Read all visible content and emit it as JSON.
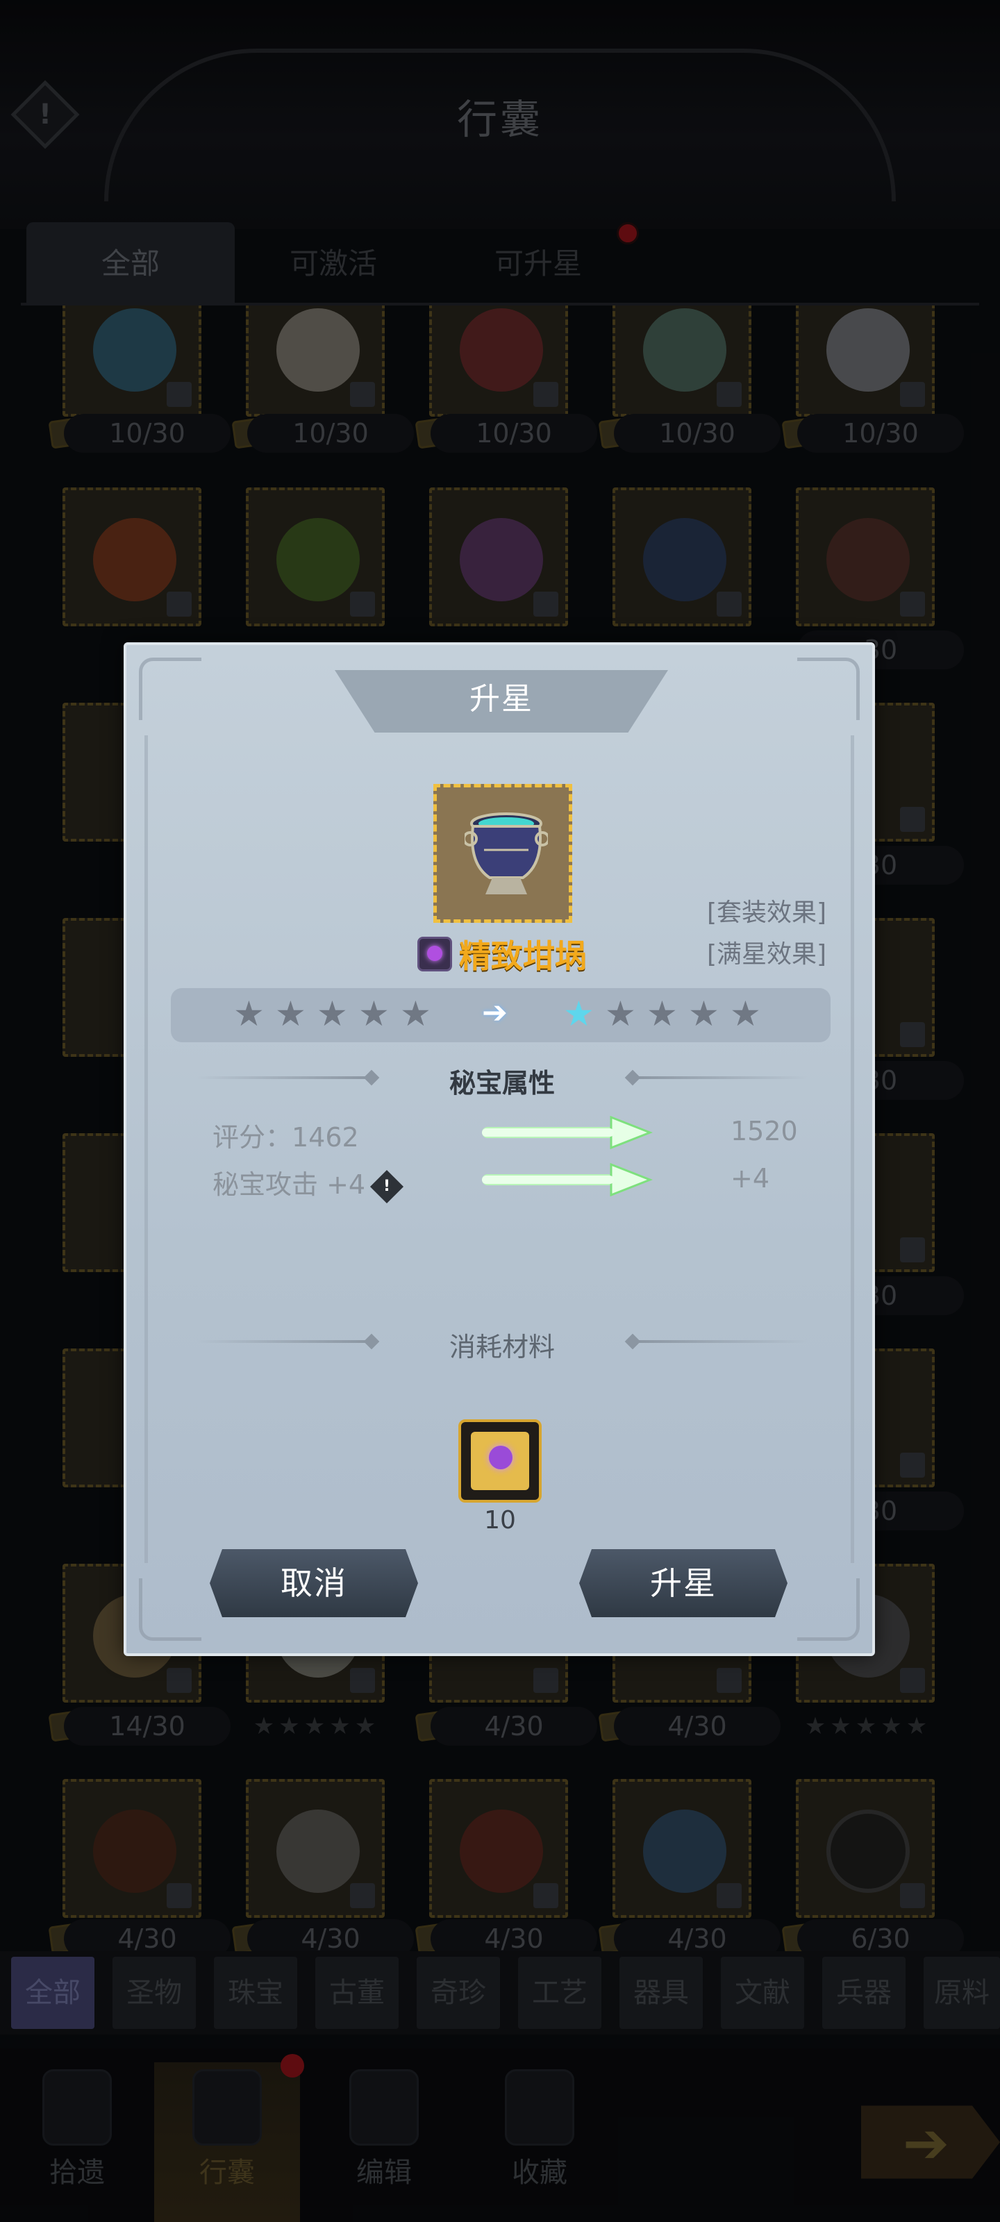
{
  "header": {
    "title": "行囊",
    "back_symbol": "!"
  },
  "tabs": [
    {
      "label": "全部",
      "active": true
    },
    {
      "label": "可激活",
      "active": false
    },
    {
      "label": "可升星",
      "active": false,
      "has_dot": true
    }
  ],
  "grid_counts": {
    "row1": [
      "10/30",
      "10/30",
      "10/30",
      "10/30",
      "10/30"
    ],
    "row2_last": "30",
    "row3_last": "30",
    "row4_last": "30",
    "row5_last": "30",
    "row6_last": "30",
    "row7": [
      "14/30",
      "★★★★★",
      "4/30",
      "4/30",
      "★★★★★"
    ],
    "row8": [
      "4/30",
      "4/30",
      "4/30",
      "4/30",
      "6/30"
    ]
  },
  "categories": [
    "全部",
    "圣物",
    "珠宝",
    "古董",
    "奇珍",
    "工艺",
    "器具",
    "文献",
    "兵器",
    "原料"
  ],
  "bottom_nav": [
    {
      "label": "拾遗"
    },
    {
      "label": "行囊",
      "active": true
    },
    {
      "label": "编辑"
    },
    {
      "label": "收藏"
    }
  ],
  "go_symbol": "➔",
  "modal": {
    "title": "升星",
    "set_effect_link": "[套装效果]",
    "max_star_link": "[满星效果]",
    "item_name": "精致坩埚",
    "stars_before": [
      "★",
      "★",
      "★",
      "★",
      "★"
    ],
    "stars_after": [
      "★",
      "★",
      "★",
      "★",
      "★"
    ],
    "stars_after_lit": 1,
    "star_arrow": "➔",
    "attr_section": "秘宝属性",
    "score_label": "评分：1462",
    "score_after": "1520",
    "attack_label": "秘宝攻击 +4",
    "attack_after": "+4",
    "info_symbol": "!",
    "material_section": "消耗材料",
    "material_qty": "10",
    "cancel_label": "取消",
    "confirm_label": "升星"
  },
  "colors": {
    "accent_gold": "#f2a91c",
    "current_star": "#5ed6ec",
    "modal_bg": "#b4c2cf",
    "button": "#2f3944",
    "alert": "#a3151d"
  }
}
